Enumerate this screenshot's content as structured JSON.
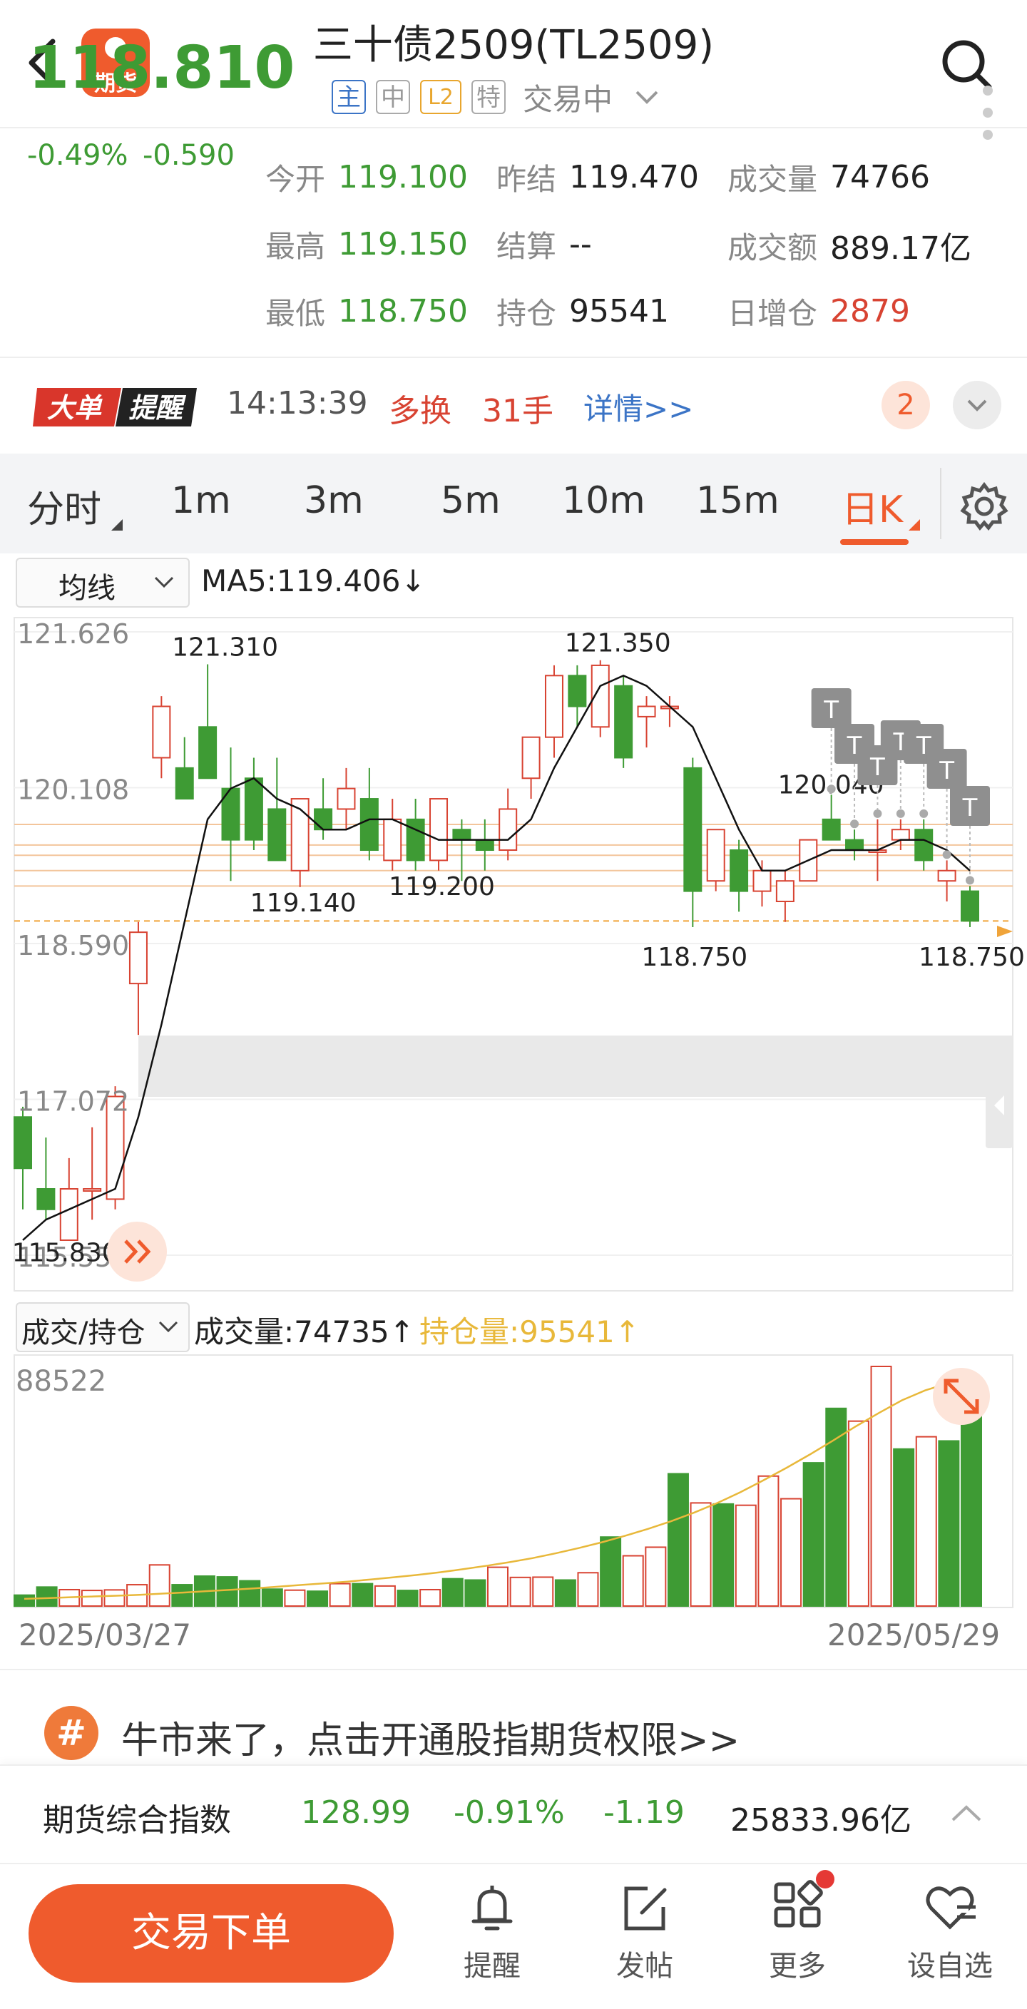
{
  "header": {
    "title": "三十债2509(TL2509)",
    "tags": [
      "主",
      "中",
      "L2",
      "特"
    ],
    "status": "交易中"
  },
  "logo": {
    "label": "期货"
  },
  "quote": {
    "last": "118.810",
    "change_pct": "-0.49%",
    "change": "-0.590",
    "fields": [
      {
        "label": "今开",
        "value": "119.100",
        "color": "green"
      },
      {
        "label": "昨结",
        "value": "119.470",
        "color": "black"
      },
      {
        "label": "成交量",
        "value": "74766",
        "color": "black"
      },
      {
        "label": "最高",
        "value": "119.150",
        "color": "green"
      },
      {
        "label": "结算",
        "value": "--",
        "color": "black"
      },
      {
        "label": "成交额",
        "value": "889.17亿",
        "color": "black"
      },
      {
        "label": "最低",
        "value": "118.750",
        "color": "green"
      },
      {
        "label": "持仓",
        "value": "95541",
        "color": "black"
      },
      {
        "label": "日增仓",
        "value": "2879",
        "color": "red"
      }
    ]
  },
  "alert": {
    "logo_text": [
      "大单",
      "提醒"
    ],
    "time": "14:13:39",
    "type": "多换",
    "qty": "31手",
    "detail": "详情>>",
    "badge": "2"
  },
  "tabs": [
    "分时",
    "1m",
    "3m",
    "5m",
    "10m",
    "15m",
    "日K"
  ],
  "active_tab": "日K",
  "ma": {
    "select": "均线",
    "value": "MA5:119.406↓"
  },
  "vol": {
    "select": "成交/持仓",
    "volume": "成交量:74735↑",
    "oi": "持仓量:95541↑"
  },
  "colors": {
    "up": "#d84332",
    "down": "#3e9b34",
    "accent": "#ef5b2d",
    "oi_line": "#e8b83a"
  },
  "chart_data": [
    {
      "type": "candlestick",
      "y_ticks": [
        "121.626",
        "120.108",
        "118.590",
        "117.072",
        "115.554"
      ],
      "ylim": [
        115.554,
        121.626
      ],
      "annotations": [
        "121.310",
        "121.350",
        "119.140",
        "119.200",
        "120.040",
        "118.750",
        "118.750",
        "115.830"
      ],
      "candles": [
        {
          "o": 116.9,
          "h": 117.0,
          "l": 116.0,
          "c": 116.4
        },
        {
          "o": 116.2,
          "h": 116.7,
          "l": 115.9,
          "c": 116.0
        },
        {
          "o": 115.7,
          "h": 116.5,
          "l": 115.83,
          "c": 116.2
        },
        {
          "o": 116.2,
          "h": 116.8,
          "l": 115.9,
          "c": 116.2
        },
        {
          "o": 116.1,
          "h": 117.2,
          "l": 116.0,
          "c": 117.1
        },
        {
          "o": 118.2,
          "h": 118.8,
          "l": 117.7,
          "c": 118.7
        },
        {
          "o": 120.4,
          "h": 121.0,
          "l": 120.2,
          "c": 120.9
        },
        {
          "o": 120.3,
          "h": 120.6,
          "l": 120.0,
          "c": 120.0
        },
        {
          "o": 120.7,
          "h": 121.31,
          "l": 120.2,
          "c": 120.2
        },
        {
          "o": 120.1,
          "h": 120.5,
          "l": 119.2,
          "c": 119.6
        },
        {
          "o": 120.2,
          "h": 120.4,
          "l": 119.5,
          "c": 119.6
        },
        {
          "o": 119.9,
          "h": 120.4,
          "l": 119.5,
          "c": 119.4
        },
        {
          "o": 119.3,
          "h": 120.0,
          "l": 119.14,
          "c": 120.0
        },
        {
          "o": 119.9,
          "h": 120.2,
          "l": 119.6,
          "c": 119.7
        },
        {
          "o": 119.9,
          "h": 120.3,
          "l": 119.7,
          "c": 120.1
        },
        {
          "o": 120.0,
          "h": 120.3,
          "l": 119.4,
          "c": 119.5
        },
        {
          "o": 119.4,
          "h": 120.0,
          "l": 119.3,
          "c": 119.8
        },
        {
          "o": 119.8,
          "h": 120.0,
          "l": 119.3,
          "c": 119.4
        },
        {
          "o": 119.4,
          "h": 120.0,
          "l": 119.3,
          "c": 120.0
        },
        {
          "o": 119.7,
          "h": 119.8,
          "l": 119.2,
          "c": 119.6
        },
        {
          "o": 119.6,
          "h": 119.8,
          "l": 119.3,
          "c": 119.5
        },
        {
          "o": 119.5,
          "h": 120.1,
          "l": 119.4,
          "c": 119.9
        },
        {
          "o": 120.2,
          "h": 120.6,
          "l": 120.0,
          "c": 120.6
        },
        {
          "o": 120.6,
          "h": 121.3,
          "l": 120.4,
          "c": 121.2
        },
        {
          "o": 121.2,
          "h": 121.3,
          "l": 120.7,
          "c": 120.9
        },
        {
          "o": 120.7,
          "h": 121.35,
          "l": 120.6,
          "c": 121.3
        },
        {
          "o": 121.1,
          "h": 121.2,
          "l": 120.3,
          "c": 120.4
        },
        {
          "o": 120.8,
          "h": 121.0,
          "l": 120.5,
          "c": 120.9
        },
        {
          "o": 120.9,
          "h": 121.0,
          "l": 120.7,
          "c": 120.9
        },
        {
          "o": 120.3,
          "h": 120.4,
          "l": 118.75,
          "c": 119.1
        },
        {
          "o": 119.2,
          "h": 119.7,
          "l": 119.1,
          "c": 119.7
        },
        {
          "o": 119.5,
          "h": 119.6,
          "l": 118.9,
          "c": 119.1
        },
        {
          "o": 119.1,
          "h": 119.4,
          "l": 118.95,
          "c": 119.3
        },
        {
          "o": 119.0,
          "h": 119.3,
          "l": 118.8,
          "c": 119.2
        },
        {
          "o": 119.2,
          "h": 119.6,
          "l": 119.2,
          "c": 119.6
        },
        {
          "o": 119.8,
          "h": 120.04,
          "l": 119.6,
          "c": 119.6
        },
        {
          "o": 119.6,
          "h": 119.7,
          "l": 119.4,
          "c": 119.5
        },
        {
          "o": 119.5,
          "h": 119.8,
          "l": 119.2,
          "c": 119.5
        },
        {
          "o": 119.6,
          "h": 119.8,
          "l": 119.5,
          "c": 119.7
        },
        {
          "o": 119.7,
          "h": 119.8,
          "l": 119.3,
          "c": 119.4
        },
        {
          "o": 119.2,
          "h": 119.4,
          "l": 119.0,
          "c": 119.3
        },
        {
          "o": 119.1,
          "h": 119.15,
          "l": 118.75,
          "c": 118.81
        }
      ],
      "ma5": [
        115.7,
        115.9,
        116.0,
        116.1,
        116.2,
        116.9,
        117.8,
        118.8,
        119.8,
        120.1,
        120.2,
        120.0,
        119.9,
        119.7,
        119.7,
        119.8,
        119.8,
        119.7,
        119.6,
        119.6,
        119.6,
        119.6,
        119.8,
        120.3,
        120.7,
        121.1,
        121.2,
        121.1,
        120.9,
        120.7,
        120.2,
        119.7,
        119.3,
        119.3,
        119.4,
        119.5,
        119.5,
        119.5,
        119.6,
        119.6,
        119.5,
        119.3
      ]
    },
    {
      "type": "bar",
      "y_ticks": [
        "88522"
      ],
      "x_start": "2025/03/27",
      "x_end": "2025/05/29",
      "volumes": [
        4200,
        7300,
        6300,
        6000,
        6200,
        8200,
        15800,
        8200,
        11500,
        11200,
        9700,
        6500,
        6100,
        5700,
        8600,
        8600,
        7700,
        6000,
        6300,
        10500,
        10000,
        14900,
        11000,
        11100,
        10000,
        12800,
        26500,
        19300,
        22600,
        50800,
        39600,
        39200,
        38700,
        49900,
        41200,
        55000,
        75900,
        71000,
        92000,
        60300,
        65000,
        63400,
        74735
      ],
      "oi": [
        3000,
        3300,
        3700,
        4000,
        4300,
        4700,
        5200,
        5700,
        6300,
        6800,
        7400,
        8100,
        8800,
        9500,
        10200,
        11100,
        12000,
        13000,
        14100,
        15400,
        16800,
        18300,
        20000,
        22000,
        24200,
        26600,
        29300,
        32200,
        35400,
        39000,
        43000,
        47500,
        52500,
        57700,
        63200,
        69000,
        75000,
        80600,
        85900,
        90000,
        93000,
        95541
      ]
    }
  ],
  "promo": {
    "icon": "#",
    "text": "牛市来了，点击开通股指期货权限>>"
  },
  "index_bar": {
    "name": "期货综合指数",
    "value": "128.99",
    "pct": "-0.91%",
    "chg": "-1.19",
    "amount": "25833.96亿"
  },
  "dates": {
    "start": "2025/03/27",
    "end": "2025/05/29"
  },
  "nav": {
    "trade": "交易下单",
    "items": [
      "提醒",
      "发帖",
      "更多",
      "设自选"
    ]
  }
}
